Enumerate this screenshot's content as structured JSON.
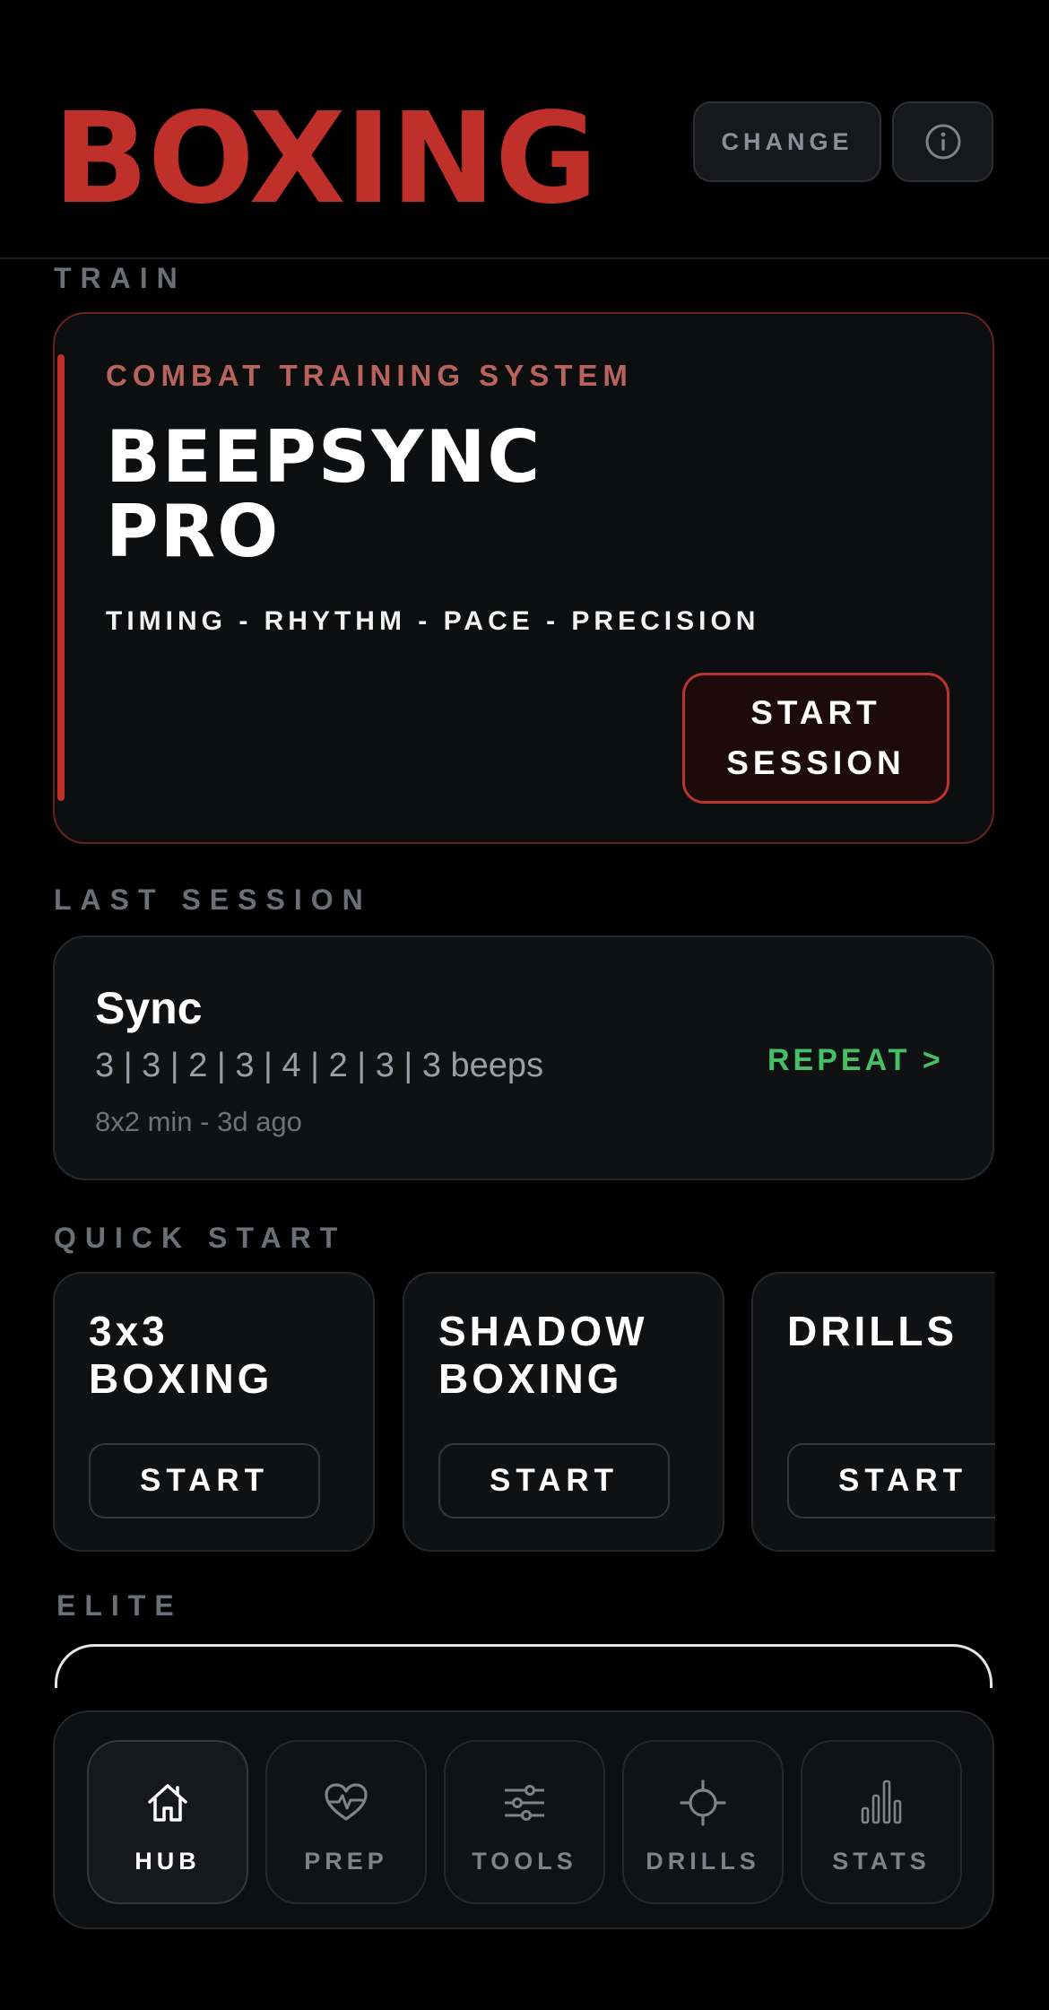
{
  "header": {
    "brand": "BOXING",
    "change_label": "CHANGE",
    "info_icon": "info-icon"
  },
  "sections": {
    "train": "TRAIN",
    "last_session": "LAST SESSION",
    "quick_start": "QUICK START",
    "elite": "ELITE"
  },
  "hero": {
    "kicker": "COMBAT TRAINING SYSTEM",
    "title_line1": "BEEPSYNC",
    "title_line2": "PRO",
    "tagline": "TIMING - RHYTHM - PACE - PRECISION",
    "cta_line1": "START",
    "cta_line2": "SESSION"
  },
  "last_session": {
    "title": "Sync",
    "pattern": "3 | 3 | 2 | 3 | 4 | 2 | 3 | 3 beeps",
    "meta": "8x2 min  -  3d ago",
    "repeat_label": "REPEAT >"
  },
  "quick_start": [
    {
      "line1": "3x3",
      "line2": "BOXING",
      "button": "START"
    },
    {
      "line1": "SHADOW",
      "line2": "BOXING",
      "button": "START"
    },
    {
      "line1": "DRILLS",
      "line2": "",
      "button": "START"
    }
  ],
  "tabbar": {
    "items": [
      {
        "label": "HUB",
        "icon": "home-icon",
        "active": true
      },
      {
        "label": "PREP",
        "icon": "heart-pulse-icon",
        "active": false
      },
      {
        "label": "TOOLS",
        "icon": "sliders-icon",
        "active": false
      },
      {
        "label": "DRILLS",
        "icon": "crosshair-icon",
        "active": false
      },
      {
        "label": "STATS",
        "icon": "bar-chart-icon",
        "active": false
      }
    ]
  },
  "colors": {
    "accent_red": "#c0302a",
    "repeat_green": "#46c065",
    "background": "#000000"
  }
}
